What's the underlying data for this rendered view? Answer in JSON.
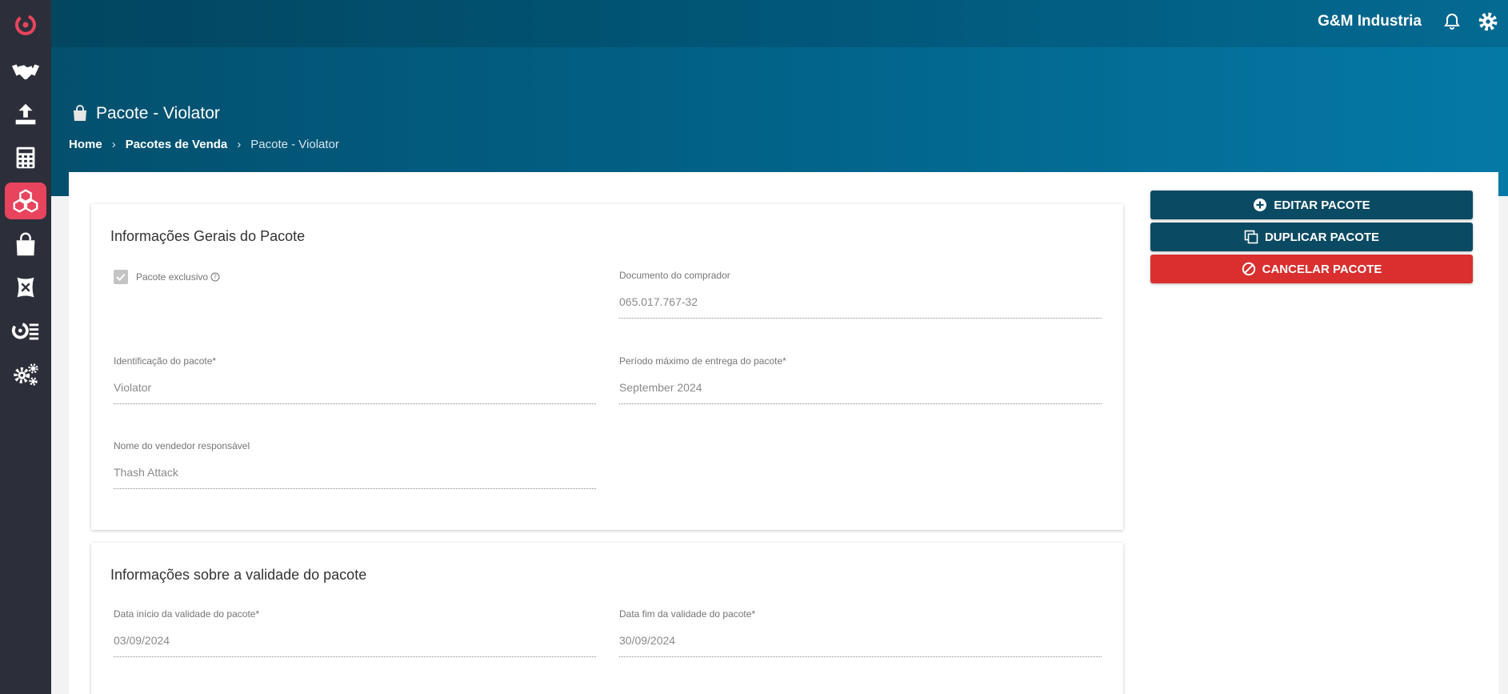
{
  "header": {
    "org_name": "G&M Industria"
  },
  "sidebar": {
    "items": [
      {
        "icon": "handshake-icon"
      },
      {
        "icon": "upload-icon"
      },
      {
        "icon": "calculator-icon"
      },
      {
        "icon": "boxes-icon",
        "active": true
      },
      {
        "icon": "shopping-bag-icon"
      },
      {
        "icon": "seed-bag-icon"
      },
      {
        "icon": "brand-list-icon"
      },
      {
        "icon": "gears-icon"
      }
    ]
  },
  "page": {
    "title": "Pacote - Violator",
    "breadcrumb": [
      "Home",
      "Pacotes de Venda",
      "Pacote - Violator"
    ]
  },
  "general_info": {
    "title": "Informações Gerais do Pacote",
    "exclusive_label": "Pacote exclusivo",
    "exclusive_checked": true,
    "buyer_doc_label": "Documento do comprador",
    "buyer_doc_value": "065.017.767-32",
    "package_id_label": "Identificação do pacote*",
    "package_id_value": "Violator",
    "delivery_label": "Período máximo de entrega do pacote*",
    "delivery_value": "September 2024",
    "seller_label": "Nome do vendedor responsável",
    "seller_value": "Thash Attack"
  },
  "validity": {
    "title": "Informações sobre a validade do pacote",
    "start_label": "Data início da validade do pacote*",
    "start_value": "03/09/2024",
    "end_label": "Data fim da validade do pacote*",
    "end_value": "30/09/2024"
  },
  "actions": {
    "edit_label": "EDITAR PACOTE",
    "duplicate_label": "DUPLICAR PACOTE",
    "cancel_label": "CANCELAR PACOTE"
  },
  "colors": {
    "sidebar_bg": "#2c2f3a",
    "accent": "#e8445e",
    "header_blue": "#02658c",
    "button_dark": "#0b4a63",
    "button_red": "#d9302f"
  }
}
